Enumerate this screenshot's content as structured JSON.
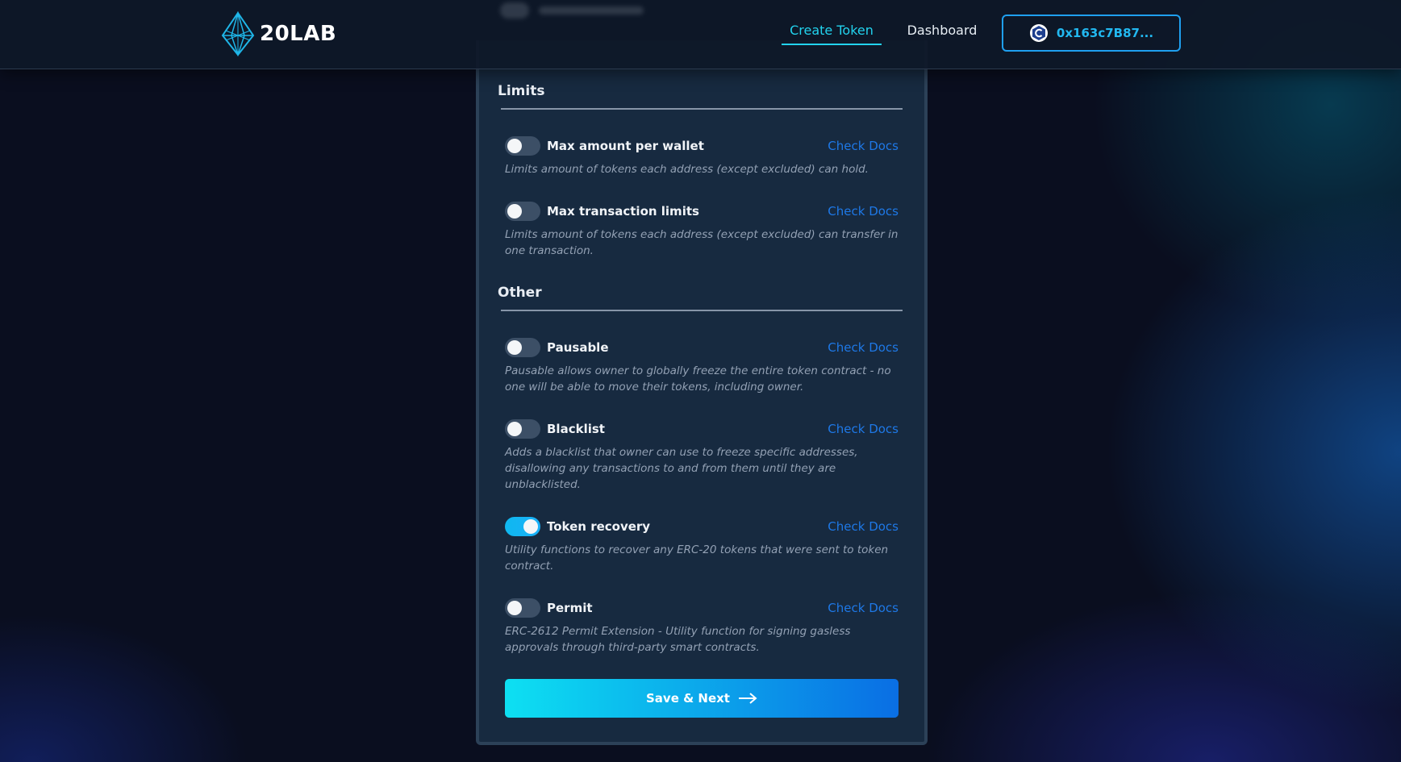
{
  "header": {
    "logo_text": "20LAB",
    "nav": {
      "create_token": "Create Token",
      "dashboard": "Dashboard"
    },
    "wallet": {
      "address": "0x163c7B87..."
    }
  },
  "sections": {
    "limits": {
      "title": "Limits"
    },
    "other": {
      "title": "Other"
    }
  },
  "options": {
    "max_wallet": {
      "label": "Max amount per wallet",
      "docs": "Check Docs",
      "enabled": false,
      "description": "Limits amount of tokens each address (except excluded) can hold."
    },
    "max_tx": {
      "label": "Max transaction limits",
      "docs": "Check Docs",
      "enabled": false,
      "description": "Limits amount of tokens each address (except excluded) can transfer in one transaction."
    },
    "pausable": {
      "label": "Pausable",
      "docs": "Check Docs",
      "enabled": false,
      "description": "Pausable allows owner to globally freeze the entire token contract - no one will be able to move their tokens, including owner."
    },
    "blacklist": {
      "label": "Blacklist",
      "docs": "Check Docs",
      "enabled": false,
      "description": "Adds a blacklist that owner can use to freeze specific addresses, disallowing any transactions to and from them until they are unblacklisted."
    },
    "token_recovery": {
      "label": "Token recovery",
      "docs": "Check Docs",
      "enabled": true,
      "description": "Utility functions to recover any ERC-20 tokens that were sent to token contract."
    },
    "permit": {
      "label": "Permit",
      "docs": "Check Docs",
      "enabled": false,
      "description": "ERC-2612 Permit Extension - Utility function for signing gasless approvals through third-party smart contracts."
    }
  },
  "actions": {
    "save_next": "Save & Next"
  },
  "colors": {
    "accent": "#22d3ee",
    "link": "#1e78e6",
    "card_bg": "#172a40",
    "page_bg": "#0a0e1f"
  }
}
